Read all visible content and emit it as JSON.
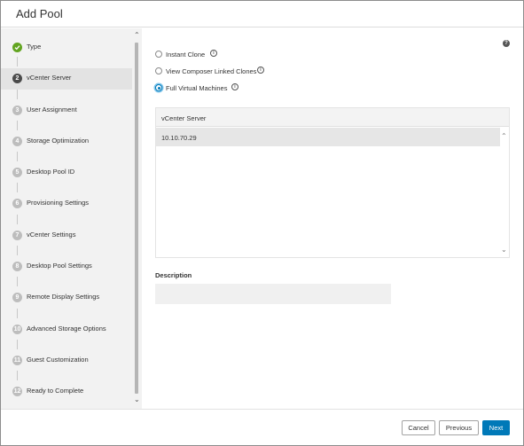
{
  "dialog": {
    "title": "Add Pool"
  },
  "steps": [
    {
      "num": "1",
      "label": "Type",
      "state": "done"
    },
    {
      "num": "2",
      "label": "vCenter Server",
      "state": "active"
    },
    {
      "num": "3",
      "label": "User Assignment",
      "state": "pending"
    },
    {
      "num": "4",
      "label": "Storage Optimization",
      "state": "pending"
    },
    {
      "num": "5",
      "label": "Desktop Pool ID",
      "state": "pending"
    },
    {
      "num": "6",
      "label": "Provisioning Settings",
      "state": "pending"
    },
    {
      "num": "7",
      "label": "vCenter Settings",
      "state": "pending"
    },
    {
      "num": "8",
      "label": "Desktop Pool Settings",
      "state": "pending"
    },
    {
      "num": "9",
      "label": "Remote Display Settings",
      "state": "pending"
    },
    {
      "num": "10",
      "label": "Advanced Storage Options",
      "state": "pending"
    },
    {
      "num": "11",
      "label": "Guest Customization",
      "state": "pending"
    },
    {
      "num": "12",
      "label": "Ready to Complete",
      "state": "pending"
    }
  ],
  "clone_options": [
    {
      "label": "Instant Clone",
      "checked": false
    },
    {
      "label": "View Composer Linked Clones",
      "checked": false
    },
    {
      "label": "Full Virtual Machines",
      "checked": true
    }
  ],
  "vcenter_table": {
    "header": "vCenter Server",
    "rows": [
      "10.10.70.29"
    ]
  },
  "description": {
    "label": "Description",
    "value": ""
  },
  "footer": {
    "cancel": "Cancel",
    "previous": "Previous",
    "next": "Next"
  },
  "icons": {
    "help": "help-icon",
    "info": "info-icon",
    "check": "check-icon",
    "scroll_up": "chevron-up-icon",
    "scroll_down": "chevron-down-icon"
  },
  "colors": {
    "primary": "#0079b8",
    "done": "#62a420",
    "active_step": "#4a4a4a"
  }
}
